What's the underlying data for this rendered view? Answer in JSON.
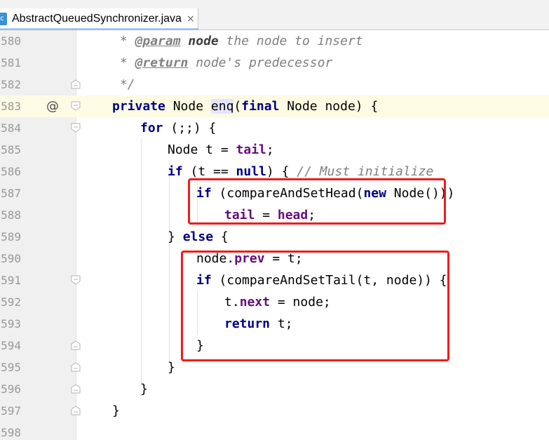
{
  "tab": {
    "icon": "c",
    "filename": "AbstractQueuedSynchronizer.java",
    "close": "×"
  },
  "gutter_marker": "@",
  "current_line": "583",
  "lines": [
    {
      "n": "580"
    },
    {
      "n": "581"
    },
    {
      "n": "582"
    },
    {
      "n": "583"
    },
    {
      "n": "584"
    },
    {
      "n": "585"
    },
    {
      "n": "586"
    },
    {
      "n": "587"
    },
    {
      "n": "588"
    },
    {
      "n": "589"
    },
    {
      "n": "590"
    },
    {
      "n": "591"
    },
    {
      "n": "592"
    },
    {
      "n": "593"
    },
    {
      "n": "594"
    },
    {
      "n": "595"
    },
    {
      "n": "596"
    },
    {
      "n": "597"
    },
    {
      "n": "598"
    }
  ],
  "code": {
    "l580": {
      "star": " * ",
      "tag": "@param",
      "sp": " ",
      "param": "node",
      "rest": " the node to insert"
    },
    "l581": {
      "star": " * ",
      "tag": "@return",
      "rest": " node's predecessor"
    },
    "l582": {
      "text": " */"
    },
    "l583": {
      "kw1": "private",
      "t1": " Node ",
      "method": "enq",
      "t2": "(",
      "kw2": "final",
      "t3": " Node node) {"
    },
    "l584": {
      "kw": "for",
      "t": " (;;) {"
    },
    "l585": {
      "t1": "Node t = ",
      "fld": "tail",
      "t2": ";"
    },
    "l586": {
      "kw1": "if",
      "t1": " (t == ",
      "kw2": "null",
      "t2": ") { ",
      "cm": "// Must initialize"
    },
    "l587": {
      "kw1": "if",
      "t1": " (compareAndSetHead(",
      "kw2": "new",
      "t2": " Node()))"
    },
    "l588": {
      "fld1": "tail",
      "t1": " = ",
      "fld2": "head",
      "t2": ";"
    },
    "l589": {
      "t1": "} ",
      "kw": "else",
      "t2": " {"
    },
    "l590": {
      "t1": "node.",
      "fld": "prev",
      "t2": " = t;"
    },
    "l591": {
      "kw": "if",
      "t": " (compareAndSetTail(t, node)) {"
    },
    "l592": {
      "t1": "t.",
      "fld": "next",
      "t2": " = node;"
    },
    "l593": {
      "kw": "return",
      "t": " t;"
    },
    "l594": {
      "t": "}"
    },
    "l595": {
      "t": "}"
    },
    "l596": {
      "t": "}"
    },
    "l597": {
      "t": "}"
    }
  },
  "annotations": [
    {
      "label": "highlight-box-1",
      "color": "#ee1c1c",
      "covers_lines": [
        "587",
        "588"
      ]
    },
    {
      "label": "highlight-box-2",
      "color": "#ee1c1c",
      "covers_lines": [
        "590",
        "594"
      ]
    }
  ]
}
